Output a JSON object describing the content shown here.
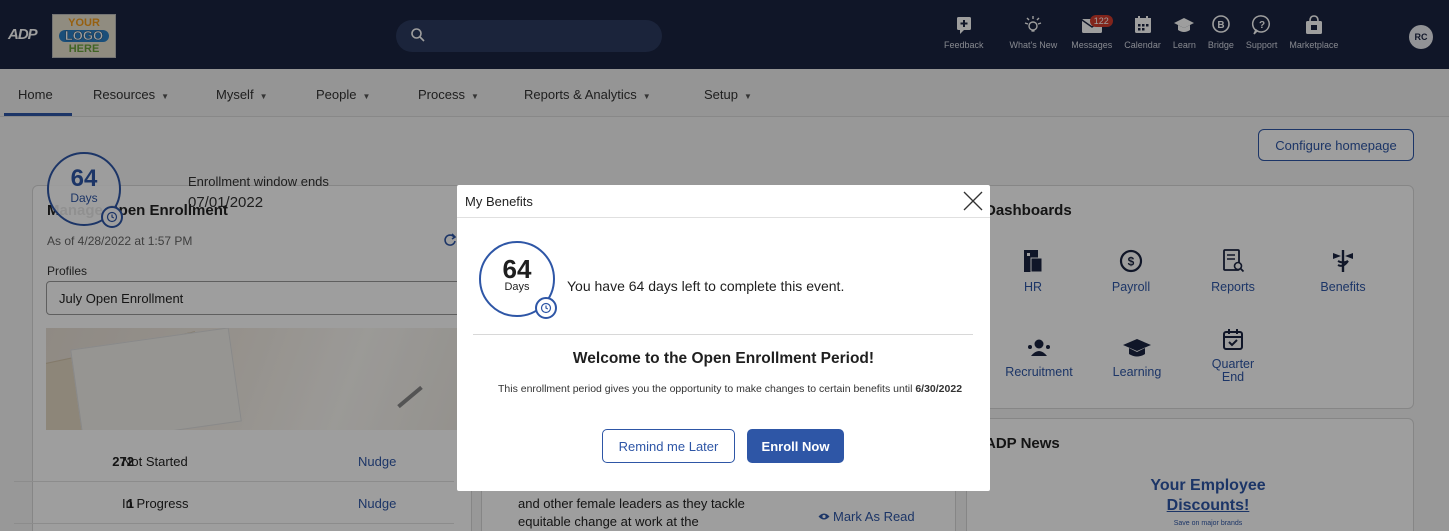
{
  "topbar": {
    "brand": "ADP",
    "logo_line1": "YOUR",
    "logo_line2": "LOGO",
    "logo_line3": "HERE",
    "search_placeholder": "",
    "icons": [
      {
        "icon": "feedback-icon",
        "label": "Feedback"
      },
      {
        "icon": "whats-new-icon",
        "label": "What's New"
      },
      {
        "icon": "messages-icon",
        "label": "Messages",
        "badge": "122"
      },
      {
        "icon": "calendar-icon",
        "label": "Calendar"
      },
      {
        "icon": "learn-icon",
        "label": "Learn"
      },
      {
        "icon": "bridge-icon",
        "label": "Bridge"
      },
      {
        "icon": "support-icon",
        "label": "Support"
      },
      {
        "icon": "marketplace-icon",
        "label": "Marketplace"
      }
    ],
    "avatar_initials": "RC"
  },
  "nav": {
    "home": "Home",
    "resources": "Resources",
    "myself": "Myself",
    "people": "People",
    "process": "Process",
    "reports": "Reports & Analytics",
    "setup": "Setup"
  },
  "configure_label": "Configure homepage",
  "enrollment": {
    "title": "Manage Open Enrollment",
    "as_of": "As of 4/28/2022 at 1:57 PM",
    "profiles_label": "Profiles",
    "profile_value": "July Open Enrollment",
    "days_number": "64",
    "days_unit": "Days",
    "window_label": "Enrollment window ends",
    "window_date": "07/01/2022",
    "rows": [
      {
        "count": "272",
        "status": "Not Started",
        "action": "Nudge"
      },
      {
        "count": "1",
        "status": "In Progress",
        "action": "Nudge"
      }
    ]
  },
  "news": {
    "snippet_line1": "and other female leaders as they tackle",
    "snippet_line2": "equitable change at work at the",
    "mark_read": "Mark As Read"
  },
  "dashboards": {
    "title": "Dashboards",
    "tiles": [
      {
        "label": "HR",
        "icon": "hr-icon"
      },
      {
        "label": "Payroll",
        "icon": "payroll-icon"
      },
      {
        "label": "Reports",
        "icon": "reports-icon"
      },
      {
        "label": "Benefits",
        "icon": "benefits-icon"
      },
      {
        "label": "Recruitment",
        "icon": "recruitment-icon"
      },
      {
        "label": "Learning",
        "icon": "learning-icon"
      },
      {
        "label": "Quarter End",
        "icon": "quarter-end-icon"
      }
    ]
  },
  "adp_news": {
    "title": "ADP News",
    "promo_line1": "Your Employee",
    "promo_line2": "Discounts!",
    "promo_sub": "Save on major brands"
  },
  "modal": {
    "title": "My Benefits",
    "days_number": "64",
    "days_unit": "Days",
    "days_left_text": "You have 64 days left to complete this event.",
    "welcome": "Welcome to the Open Enrollment Period!",
    "description": "This enrollment period gives you the opportunity to make changes to certain benefits until",
    "deadline": "6/30/2022",
    "remind_label": "Remind me Later",
    "enroll_label": "Enroll Now"
  },
  "colors": {
    "topbar": "#1a2441",
    "accent": "#2e56a6",
    "badge": "#d13b2d"
  }
}
